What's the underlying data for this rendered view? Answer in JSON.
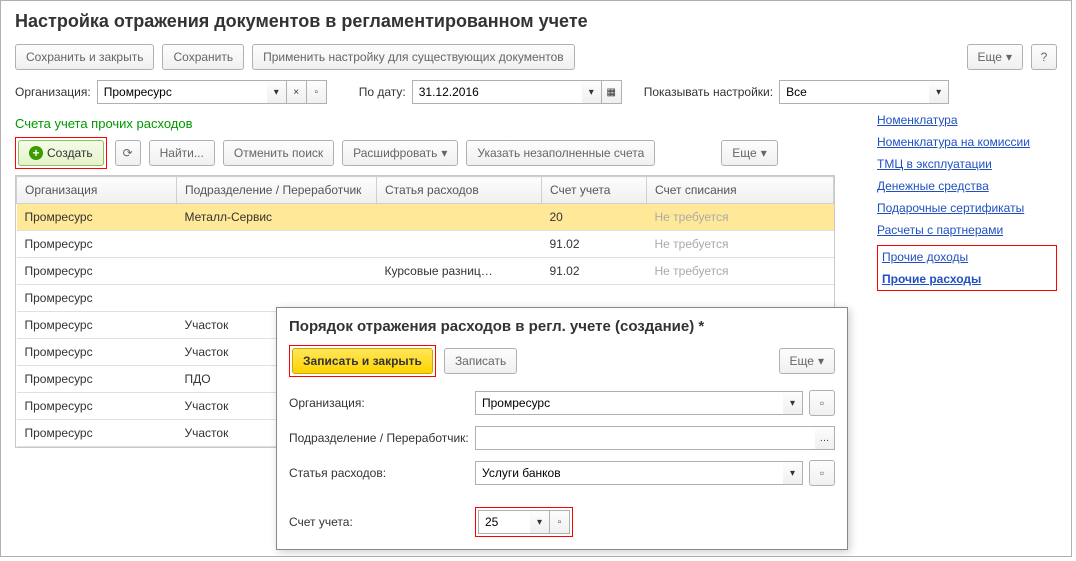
{
  "title": "Настройка отражения документов в регламентированном учете",
  "toolbar": {
    "save_close": "Сохранить и закрыть",
    "save": "Сохранить",
    "apply": "Применить настройку для существующих документов",
    "more": "Еще",
    "help": "?"
  },
  "fields": {
    "org_label": "Организация:",
    "org_value": "Промресурс",
    "date_label": "По дату:",
    "date_value": "31.12.2016",
    "show_label": "Показывать настройки:",
    "show_value": "Все"
  },
  "section_title": "Счета учета прочих расходов",
  "tool2": {
    "create": "Создать",
    "find": "Найти...",
    "cancel_find": "Отменить поиск",
    "decode": "Расшифровать",
    "unfilled": "Указать незаполненные счета",
    "more": "Еще"
  },
  "columns": {
    "org": "Организация",
    "dept": "Подразделение / Переработчик",
    "item": "Статья расходов",
    "account": "Счет учета",
    "writeoff": "Счет списания"
  },
  "rows": [
    {
      "org": "Промресурс",
      "dept": "Металл-Сервис",
      "item": "",
      "account": "20",
      "writeoff": "Не требуется",
      "sel": true
    },
    {
      "org": "Промресурс",
      "dept": "",
      "item": "",
      "account": "91.02",
      "writeoff": "Не требуется"
    },
    {
      "org": "Промресурс",
      "dept": "",
      "item": "Курсовые разниц…",
      "account": "91.02",
      "writeoff": "Не требуется"
    },
    {
      "org": "Промресурс",
      "dept": "",
      "item": "",
      "account": "",
      "writeoff": ""
    },
    {
      "org": "Промресурс",
      "dept": "Участок",
      "item": "",
      "account": "",
      "writeoff": ""
    },
    {
      "org": "Промресурс",
      "dept": "Участок",
      "item": "",
      "account": "",
      "writeoff": ""
    },
    {
      "org": "Промресурс",
      "dept": "ПДО",
      "item": "",
      "account": "",
      "writeoff": ""
    },
    {
      "org": "Промресурс",
      "dept": "Участок",
      "item": "",
      "account": "",
      "writeoff": ""
    },
    {
      "org": "Промресурс",
      "dept": "Участок",
      "item": "",
      "account": "",
      "writeoff": ""
    }
  ],
  "navlinks": [
    "Номенклатура",
    "Номенклатура на комиссии",
    "ТМЦ в эксплуатации",
    "Денежные средства",
    "Подарочные сертификаты",
    "Расчеты с партнерами",
    "Прочие доходы",
    "Прочие расходы"
  ],
  "dialog": {
    "title": "Порядок отражения расходов в регл. учете (создание) *",
    "save_close": "Записать и закрыть",
    "save": "Записать",
    "more": "Еще",
    "org_label": "Организация:",
    "org_value": "Промресурс",
    "dept_label": "Подразделение / Переработчик:",
    "dept_value": "",
    "item_label": "Статья расходов:",
    "item_value": "Услуги банков",
    "account_label": "Счет учета:",
    "account_value": "25"
  }
}
